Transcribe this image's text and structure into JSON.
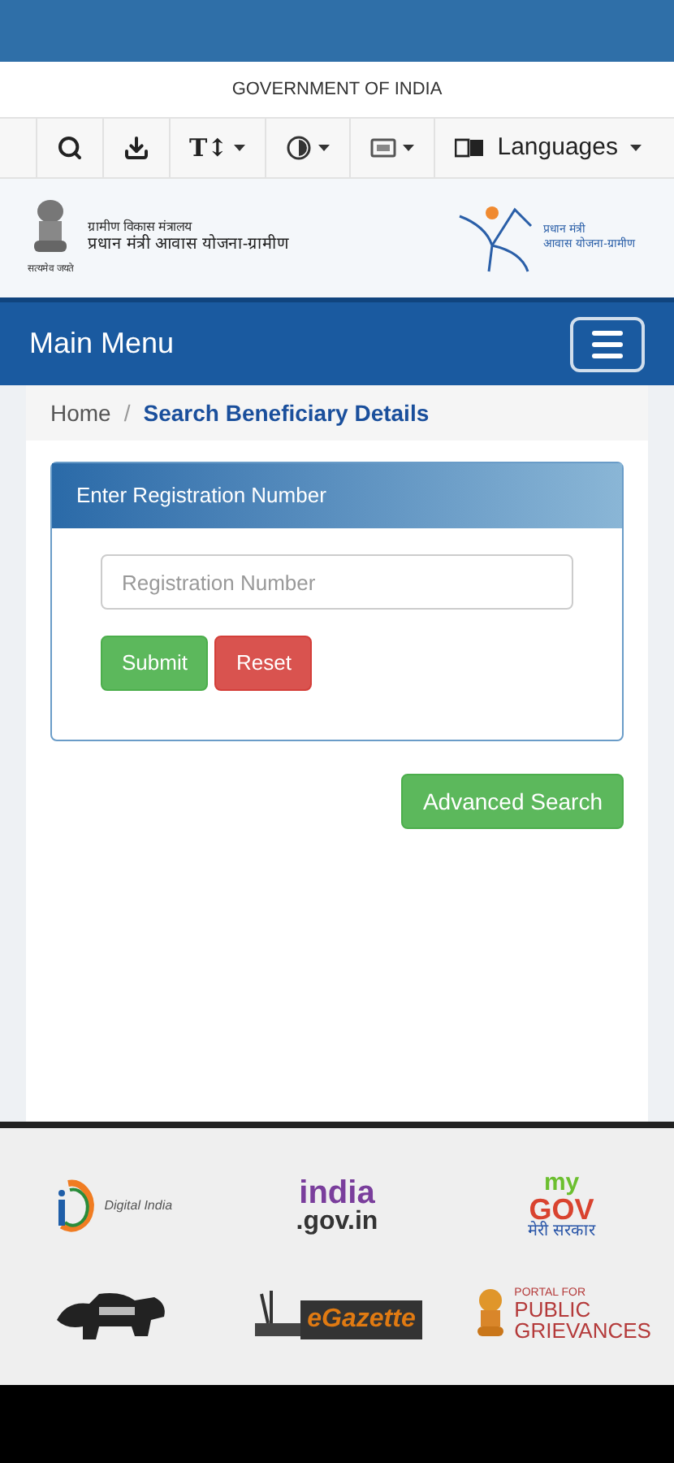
{
  "top_bar": {
    "title": "GOVERNMENT OF INDIA"
  },
  "toolbar": {
    "items": [
      {
        "kind": "search"
      },
      {
        "kind": "download"
      },
      {
        "kind": "text-size",
        "label": "T↕"
      },
      {
        "kind": "contrast"
      },
      {
        "kind": "screen"
      },
      {
        "kind": "languages",
        "label": "Languages"
      }
    ]
  },
  "header": {
    "ministry": "ग्रामीण विकास मंत्रालय",
    "scheme": "प्रधान मंत्री आवास योजना-ग्रामीण",
    "emblem_caption": "सत्यमेव जयते",
    "logo_lines": [
      "प्रधान मंत्री",
      "आवास योजना-ग्रामीण"
    ]
  },
  "nav": {
    "title": "Main Menu"
  },
  "breadcrumb": [
    {
      "label": "Home",
      "selected": false
    },
    {
      "label": "Search Beneficiary Details",
      "selected": true
    }
  ],
  "breadcrumb_separator": "/",
  "panel": {
    "title": "Enter Registration Number",
    "field": {
      "placeholder": "Registration Number"
    },
    "buttons": [
      {
        "kind": "primary",
        "label": "Submit"
      },
      {
        "kind": "danger",
        "label": "Reset"
      }
    ]
  },
  "advanced_search": "Advanced Search",
  "footer_logos": [
    {
      "kind": "digital-india",
      "text": "Digital India"
    },
    {
      "kind": "india-gov",
      "text": "india",
      "text2": ".gov.in"
    },
    {
      "kind": "mygov",
      "text": "my",
      "text2": "GOV",
      "text3": "मेरी सरकार"
    },
    {
      "kind": "make-in-india"
    },
    {
      "kind": "egazette",
      "text": "eGazette"
    },
    {
      "kind": "pgportal",
      "text": "PORTAL FOR",
      "text2": "PUBLIC",
      "text3": "GRIEVANCES"
    }
  ]
}
